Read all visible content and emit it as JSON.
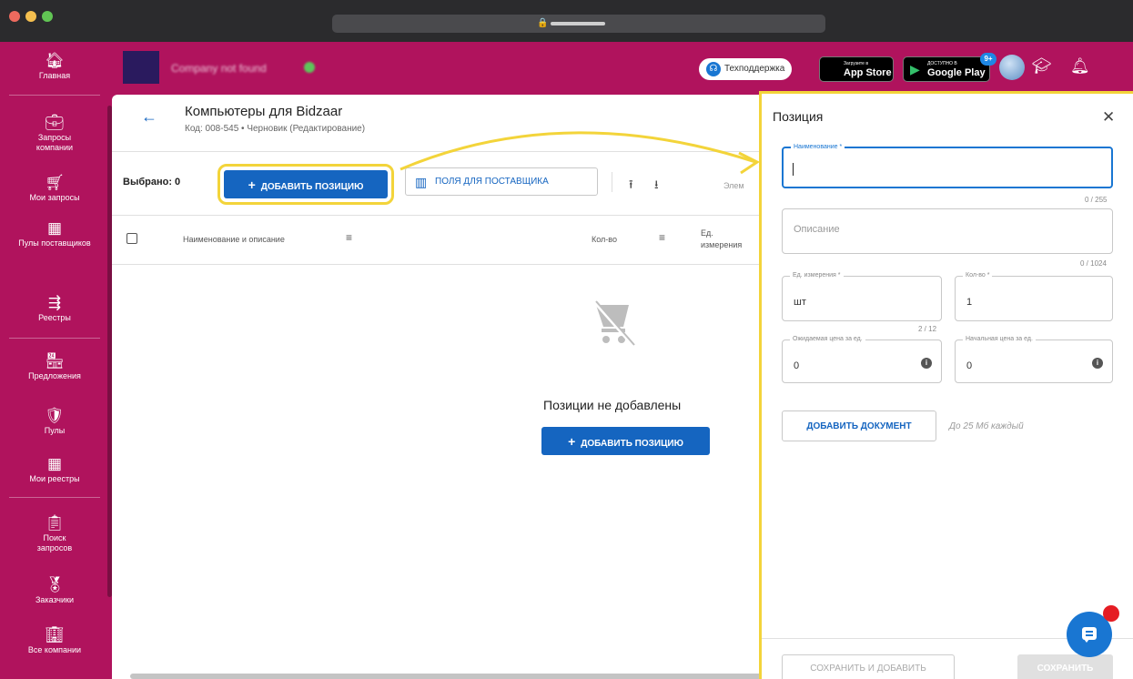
{
  "sidebar": {
    "items": [
      {
        "label": "Главная",
        "icon": "home-icon"
      },
      {
        "label": "Запросы компании",
        "icon": "briefcase-icon"
      },
      {
        "label": "Мои запросы",
        "icon": "cart-icon"
      },
      {
        "label": "Пулы поставщиков",
        "icon": "grid-plus-icon"
      },
      {
        "label": "Реестры",
        "icon": "registry-icon"
      },
      {
        "label": "Предложения",
        "icon": "storefront-icon"
      },
      {
        "label": "Пулы",
        "icon": "shield-check-icon"
      },
      {
        "label": "Мои реестры",
        "icon": "grid-plus-icon"
      },
      {
        "label": "Поиск запросов",
        "icon": "clipboard-icon"
      },
      {
        "label": "Заказчики",
        "icon": "award-icon"
      },
      {
        "label": "Все компании",
        "icon": "building-icon"
      }
    ]
  },
  "topbar": {
    "company_name": "Company not found",
    "support_label": "Техподдержка",
    "appstore_small": "Загрузите в",
    "appstore_big": "App Store",
    "gplay_small": "ДОСТУПНО В",
    "gplay_big": "Google Play",
    "notifications_badge": "9+"
  },
  "page": {
    "title": "Компьютеры для Bidzaar",
    "subtitle": "Код: 008-545 • Черновик (Редактирование)"
  },
  "toolbar": {
    "selected_label": "Выбрано: 0",
    "add_position_label": "ДОБАВИТЬ ПОЗИЦИЮ",
    "supplier_fields_label": "ПОЛЯ ДЛЯ ПОСТАВЩИКА",
    "elements_label": "Элем"
  },
  "table": {
    "col_name": "Наименование и описание",
    "col_qty": "Кол-во",
    "col_unit": "Ед. измерения"
  },
  "empty": {
    "message": "Позиции не добавлены",
    "add_label": "ДОБАВИТЬ ПОЗИЦИЮ"
  },
  "panel": {
    "title": "Позиция",
    "name_label": "Наименование *",
    "name_counter": "0 / 255",
    "desc_placeholder": "Описание",
    "desc_counter": "0 / 1024",
    "unit_label": "Ед. измерения *",
    "unit_value": "шт",
    "unit_counter": "2 / 12",
    "qty_label": "Кол-во *",
    "qty_value": "1",
    "expected_price_label": "Ожидаемая цена за ед.",
    "expected_price_value": "0",
    "start_price_label": "Начальная цена за ед.",
    "start_price_value": "0",
    "add_doc_label": "ДОБАВИТЬ ДОКУМЕНТ",
    "add_doc_hint": "До 25 Мб каждый",
    "save_add_label": "СОХРАНИТЬ И ДОБАВИТЬ",
    "save_label": "СОХРАНИТЬ"
  },
  "colors": {
    "brand": "#b0135d",
    "primary": "#1565c0",
    "highlight": "#f3d43a"
  }
}
